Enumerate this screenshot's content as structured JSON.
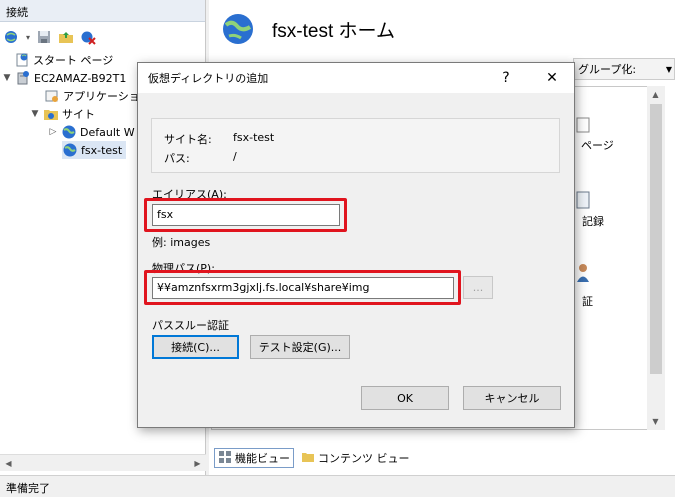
{
  "connections": {
    "header": "接続",
    "toolbar_icons": [
      "globe-connect-icon",
      "save-icon",
      "folder-up-icon",
      "disconnect-icon"
    ],
    "tree": [
      {
        "label": "スタート ページ",
        "icon": "start-page-icon"
      },
      {
        "label": "EC2AMAZ-B92T1",
        "icon": "server-icon"
      },
      {
        "label": "アプリケーション",
        "icon": "app-pool-icon"
      },
      {
        "label": "サイト",
        "icon": "sites-folder-icon"
      },
      {
        "label": "Default W",
        "icon": "globe-icon"
      },
      {
        "label": "fsx-test",
        "icon": "globe-icon"
      }
    ]
  },
  "main": {
    "title": "fsx-test ホーム",
    "group_by_label": "グループ化:",
    "feature_labels": [
      "ページ",
      "記録",
      "証"
    ],
    "view_tabs": [
      "機能ビュー",
      "コンテンツ ビュー"
    ]
  },
  "status": {
    "text": "準備完了"
  },
  "dialog": {
    "title": "仮想ディレクトリの追加",
    "help_glyph": "?",
    "close_glyph": "✕",
    "site_label": "サイト名:",
    "site_value": "fsx-test",
    "path_label": "パス:",
    "path_value": "/",
    "alias_label": "エイリアス(A):",
    "alias_value": "fsx",
    "alias_example": "例: images",
    "physical_path_label": "物理パス(P):",
    "physical_path_value": "¥¥amznfsxrm3gjxlj.fs.local¥share¥img",
    "browse_label": "...",
    "passthrough_label": "パススルー認証",
    "connect_button": "接続(C)...",
    "test_button": "テスト設定(G)...",
    "ok_button": "OK",
    "cancel_button": "キャンセル"
  },
  "colors": {
    "highlight": "#e0141e",
    "selection": "#dbe6f4",
    "focus_border": "#0078d7"
  }
}
